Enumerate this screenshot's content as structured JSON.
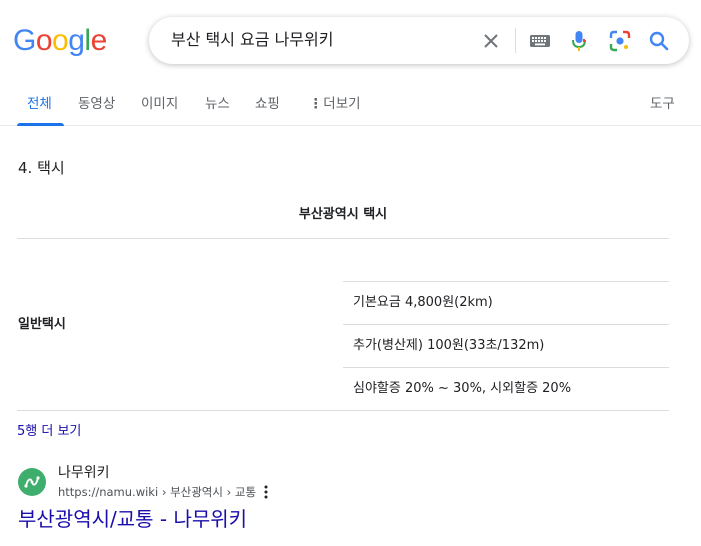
{
  "logo": {
    "letters": [
      "G",
      "o",
      "o",
      "g",
      "l",
      "e"
    ],
    "colors": [
      "#4285F4",
      "#EA4335",
      "#FBBC05",
      "#4285F4",
      "#34A853",
      "#EA4335"
    ]
  },
  "search": {
    "query": "부산 택시 요금 나무위키",
    "icons": [
      "clear-icon",
      "keyboard-icon",
      "microphone-icon",
      "lens-icon",
      "search-icon"
    ]
  },
  "tabs": {
    "all": "전체",
    "videos": "동영상",
    "images": "이미지",
    "news": "뉴스",
    "shopping": "쇼핑",
    "more": "더보기",
    "tools": "도구"
  },
  "snippet": {
    "heading": "4. 택시",
    "table_caption": "부산광역시 택시",
    "row_header": "일반택시",
    "cells": [
      "기본요금 4,800원(2km)",
      "추가(병산제) 100원(33초/132m)",
      "심야할증 20% ~ 30%, 시외할증 20%"
    ],
    "more_rows": "5행 더 보기"
  },
  "result": {
    "site_name": "나무위키",
    "url": "https://namu.wiki › 부산광역시 › 교통",
    "title": "부산광역시/교통 - 나무위키"
  },
  "colors": {
    "accent": "#1a73e8",
    "link": "#1a0dab",
    "favicon_bg": "#3fae6d"
  }
}
